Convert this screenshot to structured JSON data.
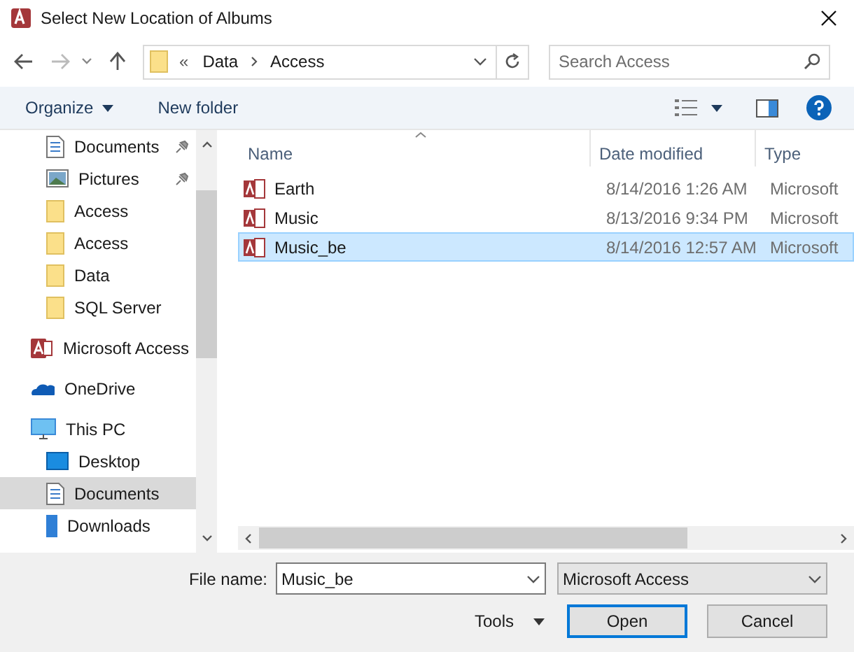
{
  "window": {
    "title": "Select New Location of Albums"
  },
  "address_bar": {
    "overflow": "«",
    "path": [
      "Data",
      "Access"
    ]
  },
  "search": {
    "placeholder": "Search Access"
  },
  "toolbar": {
    "organize": "Organize",
    "new_folder": "New folder"
  },
  "quick_access_items": [
    {
      "label": "Documents",
      "kind": "documents",
      "pinned": true,
      "selected": false
    },
    {
      "label": "Pictures",
      "kind": "pictures",
      "pinned": true,
      "selected": false
    },
    {
      "label": "Access",
      "kind": "folder",
      "pinned": false,
      "selected": false
    },
    {
      "label": "Access",
      "kind": "folder",
      "pinned": false,
      "selected": false
    },
    {
      "label": "Data",
      "kind": "folder",
      "pinned": false,
      "selected": false
    },
    {
      "label": "SQL Server",
      "kind": "folder",
      "pinned": false,
      "selected": false
    }
  ],
  "nav_items": [
    {
      "label": "Microsoft Access",
      "kind": "access",
      "selected": false
    },
    {
      "label": "OneDrive",
      "kind": "onedrive",
      "selected": false
    },
    {
      "label": "This PC",
      "kind": "pc",
      "selected": false,
      "children": [
        {
          "label": "Desktop",
          "kind": "desktop",
          "selected": false
        },
        {
          "label": "Documents",
          "kind": "documents",
          "selected": true
        },
        {
          "label": "Downloads",
          "kind": "downloads",
          "selected": false
        }
      ]
    }
  ],
  "table": {
    "columns": [
      "Name",
      "Date modified",
      "Type"
    ],
    "rows": [
      {
        "name": "Earth",
        "date": "8/14/2016 1:26 AM",
        "type": "Microsoft",
        "selected": false
      },
      {
        "name": "Music",
        "date": "8/13/2016 9:34 PM",
        "type": "Microsoft",
        "selected": false
      },
      {
        "name": "Music_be",
        "date": "8/14/2016 12:57 AM",
        "type": "Microsoft",
        "selected": true
      }
    ]
  },
  "footer": {
    "file_name_label": "File name:",
    "file_name": "Music_be",
    "filter": "Microsoft Access",
    "tools": "Tools",
    "open": "Open",
    "cancel": "Cancel"
  }
}
